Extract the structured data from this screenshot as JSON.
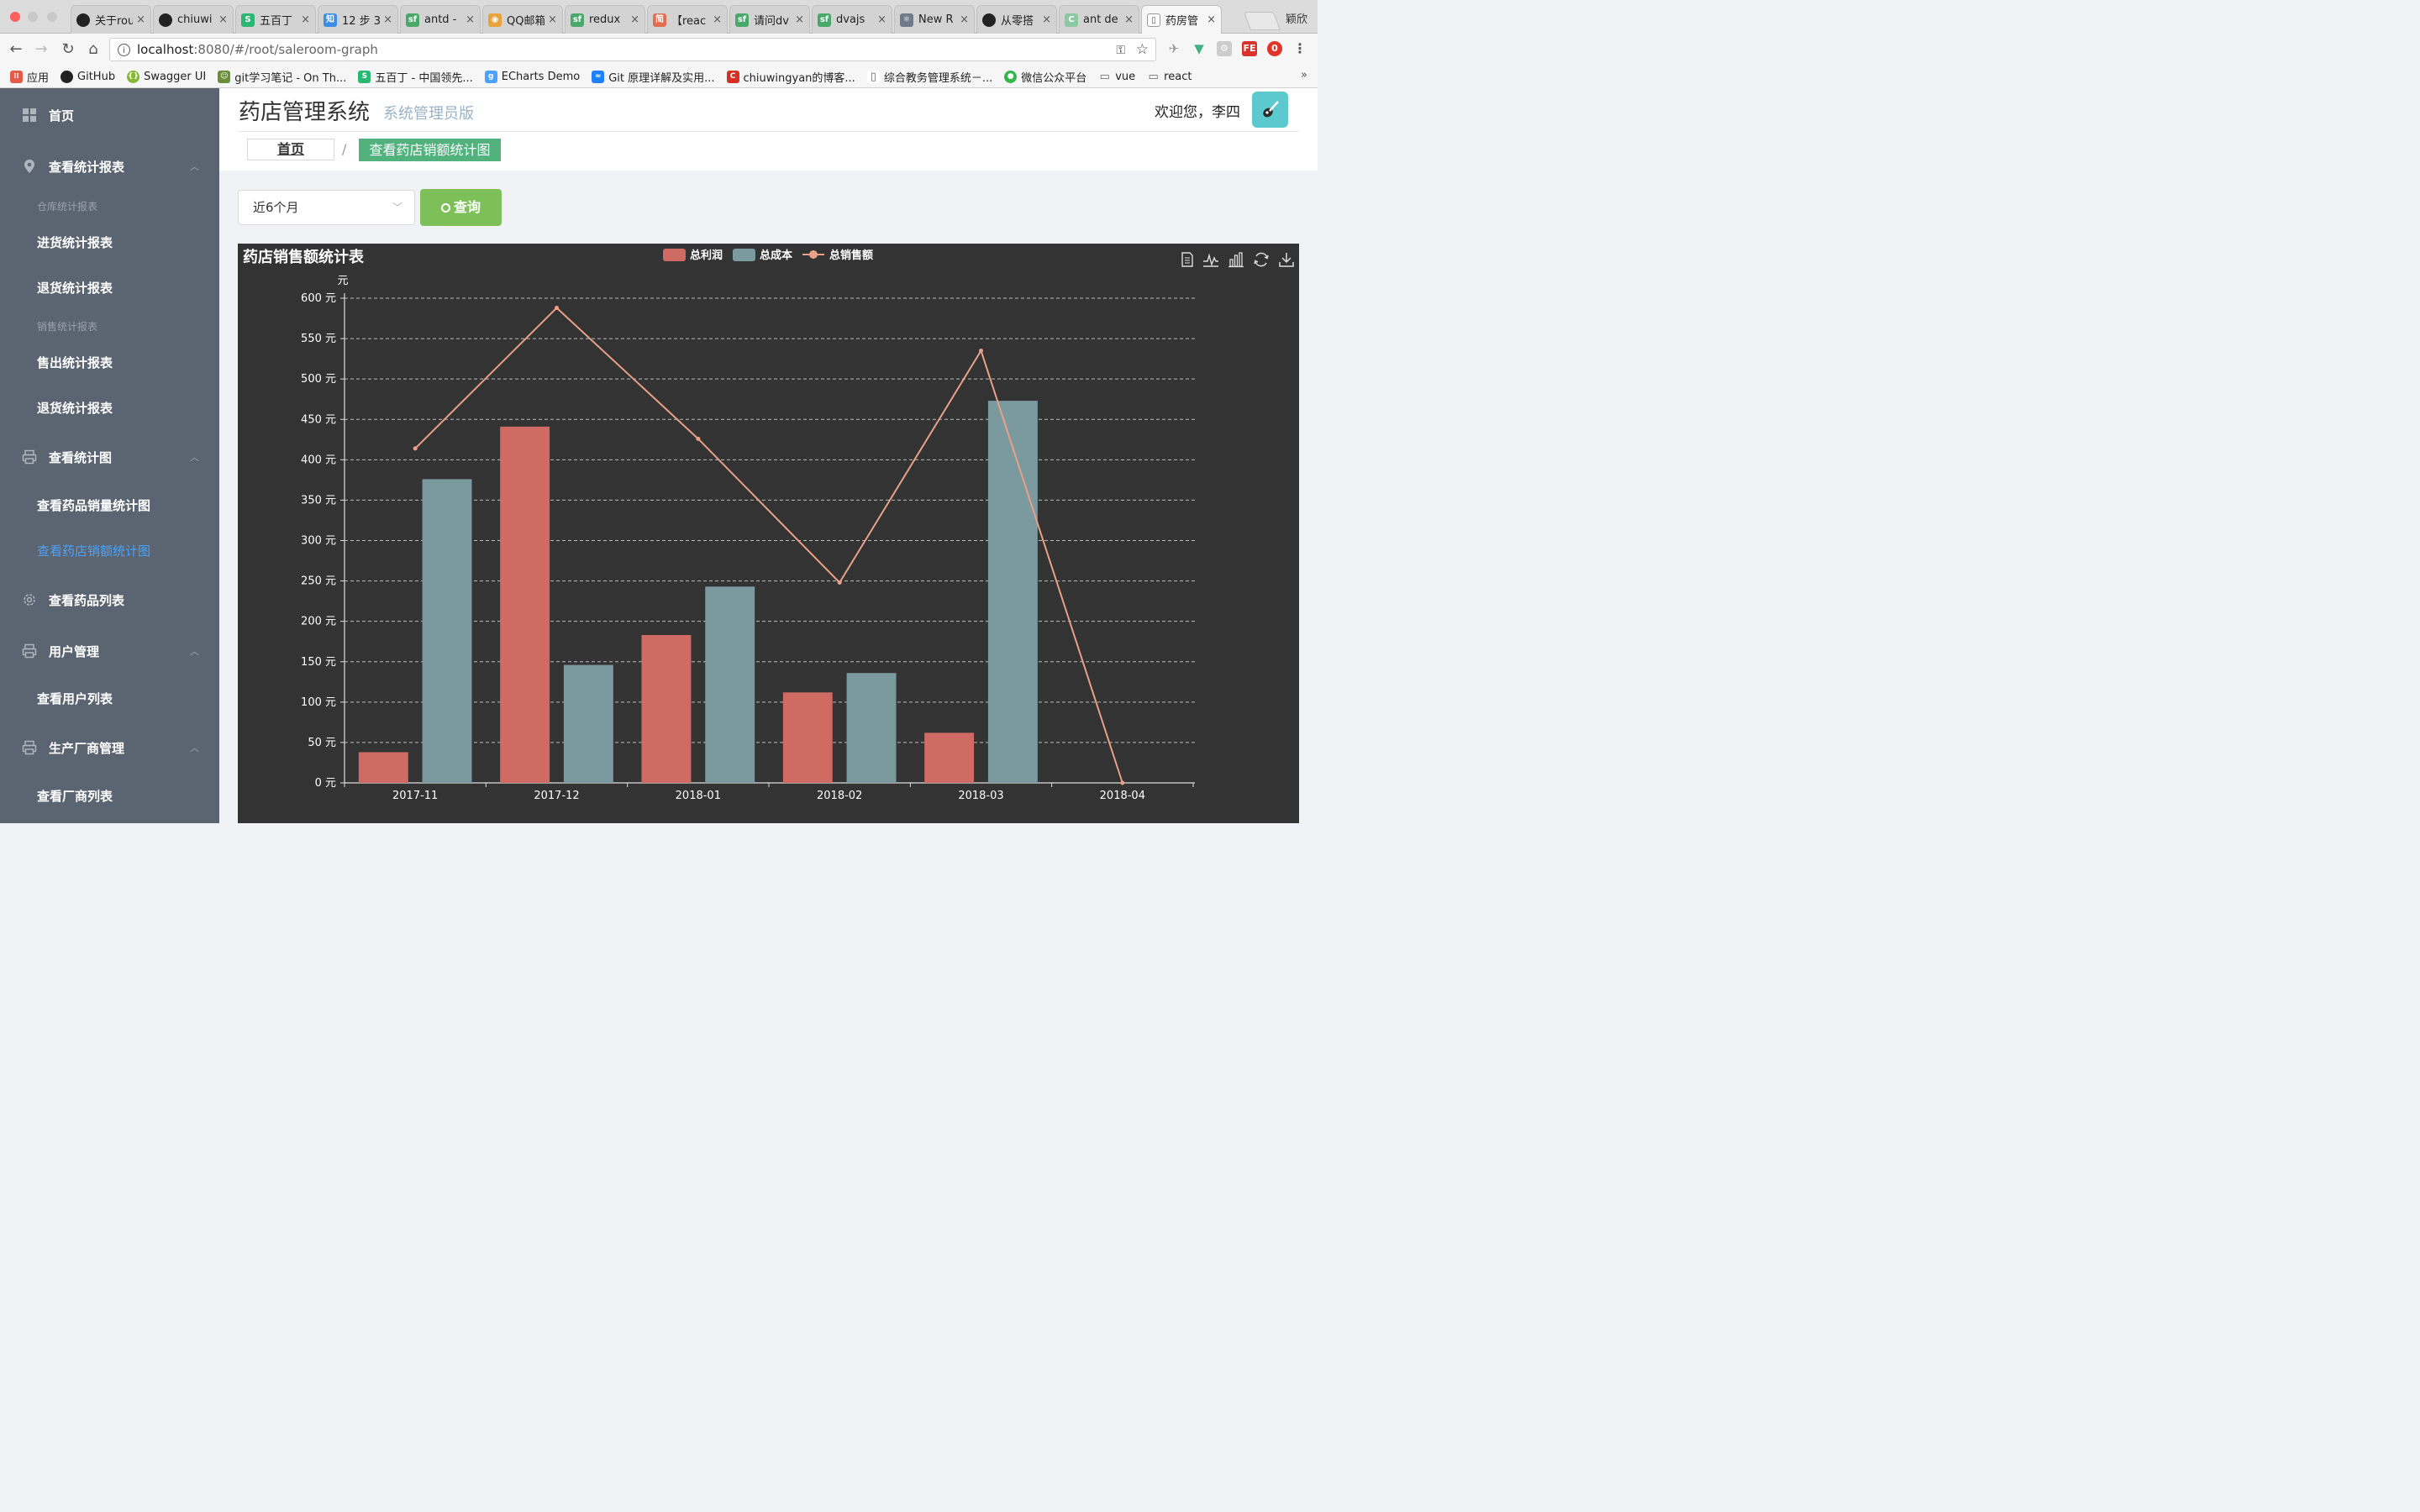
{
  "browser": {
    "tabs": [
      {
        "title": "关于rou",
        "icon": "github-icon",
        "color": "#222222",
        "glyph": ""
      },
      {
        "title": "chiuwi",
        "icon": "github-icon",
        "color": "#222222",
        "glyph": ""
      },
      {
        "title": "五百丁",
        "icon": "wubaiding-icon",
        "color": "#2bb673",
        "glyph": "S"
      },
      {
        "title": "12 步 3",
        "icon": "zhihu-icon",
        "color": "#3a8ee6",
        "glyph": "知"
      },
      {
        "title": "antd -",
        "icon": "segmentfault-icon",
        "color": "#4aa86a",
        "glyph": "sf"
      },
      {
        "title": "QQ邮箱",
        "icon": "chrome-icon",
        "color": "#e8a33c",
        "glyph": "◉"
      },
      {
        "title": "redux",
        "icon": "segmentfault-icon",
        "color": "#4aa86a",
        "glyph": "sf"
      },
      {
        "title": "【reac",
        "icon": "jianshu-icon",
        "color": "#e26d53",
        "glyph": "简"
      },
      {
        "title": "请问dv",
        "icon": "segmentfault-icon",
        "color": "#4aa86a",
        "glyph": "sf"
      },
      {
        "title": "dvajs",
        "icon": "segmentfault-icon",
        "color": "#4aa86a",
        "glyph": "sf"
      },
      {
        "title": "New R",
        "icon": "react-icon",
        "color": "#6c7a89",
        "glyph": "⚛"
      },
      {
        "title": "从零搭",
        "icon": "github-icon",
        "color": "#222222",
        "glyph": ""
      },
      {
        "title": "ant de",
        "icon": "ant-icon",
        "color": "#8bc9a3",
        "glyph": "C"
      },
      {
        "title": "药房管",
        "icon": "page-icon",
        "color": "#ffffff",
        "glyph": "▯"
      }
    ],
    "active_tab_index": 13,
    "profile_name": "颖欣",
    "url_host": "localhost",
    "url_path": ":8080/#/root/saleroom-graph",
    "bookmarks": [
      {
        "label": "应用",
        "icon": "apps-icon"
      },
      {
        "label": "GitHub",
        "icon": "github-icon"
      },
      {
        "label": "Swagger UI",
        "icon": "swagger-icon"
      },
      {
        "label": "git学习笔记 - On Th...",
        "icon": "face-icon"
      },
      {
        "label": "五百丁 - 中国领先...",
        "icon": "wubaiding-icon"
      },
      {
        "label": "ECharts Demo",
        "icon": "geo-icon"
      },
      {
        "label": "Git 原理详解及实用...",
        "icon": "juejin-icon"
      },
      {
        "label": "chiuwingyan的博客...",
        "icon": "csdn-icon"
      },
      {
        "label": "综合教务管理系统－...",
        "icon": "document-icon"
      },
      {
        "label": "微信公众平台",
        "icon": "wechat-icon"
      },
      {
        "label": "vue",
        "icon": "folder-icon"
      },
      {
        "label": "react",
        "icon": "folder-icon"
      }
    ],
    "bookmarks_more": "»"
  },
  "sidebar": {
    "home": "首页",
    "report_menu": "查看统计报表",
    "warehouse_group": "仓库统计报表",
    "purchase_report": "进货统计报表",
    "return_report_1": "退货统计报表",
    "sales_group": "销售统计报表",
    "sold_report": "售出统计报表",
    "return_report_2": "退货统计报表",
    "graph_menu": "查看统计图",
    "drug_sales_graph": "查看药品销量统计图",
    "store_sales_graph": "查看药店销额统计图",
    "drug_list_menu": "查看药品列表",
    "user_menu": "用户管理",
    "user_list": "查看用户列表",
    "vendor_menu": "生产厂商管理",
    "vendor_list": "查看厂商列表"
  },
  "header": {
    "title": "药店管理系统",
    "subtitle": "系统管理员版",
    "welcome": "欢迎您，李四"
  },
  "breadcrumb": {
    "home": "首页",
    "separator": "/",
    "current": "查看药店销额统计图"
  },
  "filter": {
    "range_value": "近6个月",
    "query_label": "查询"
  },
  "chart_data": {
    "type": "bar",
    "title": "药店销售额统计表",
    "ylabel": "元",
    "y_tick_suffix": " 元",
    "ylim": [
      0,
      600
    ],
    "y_interval": 50,
    "categories": [
      "2017-11",
      "2017-12",
      "2018-01",
      "2018-02",
      "2018-03",
      "2018-04"
    ],
    "series": [
      {
        "name": "总利润",
        "type": "bar",
        "color": "#d06b64",
        "values": [
          38,
          441,
          183,
          112,
          62,
          0
        ]
      },
      {
        "name": "总成本",
        "type": "bar",
        "color": "#7b9a9f",
        "values": [
          376,
          146,
          243,
          136,
          473,
          0
        ]
      },
      {
        "name": "总销售额",
        "type": "line",
        "color": "#e8a088",
        "values": [
          414,
          588,
          426,
          248,
          535,
          0
        ]
      }
    ],
    "grid": true,
    "legend_position": "top-center",
    "background": "#333333",
    "toolbox": [
      "data-view-icon",
      "line-chart-icon",
      "bar-chart-icon",
      "restore-icon",
      "download-icon"
    ]
  }
}
